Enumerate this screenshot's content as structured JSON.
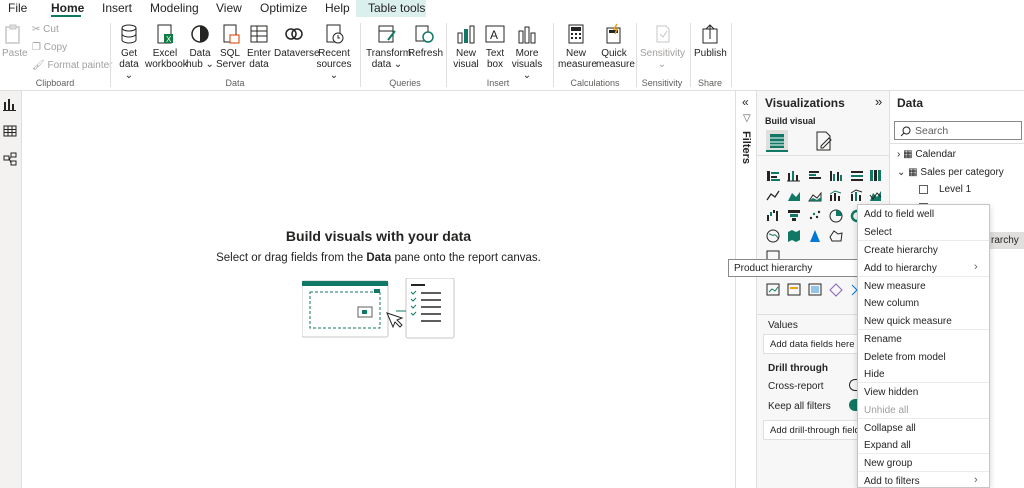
{
  "menubar": {
    "items": [
      "File",
      "Home",
      "Insert",
      "Modeling",
      "View",
      "Optimize",
      "Help",
      "Table tools"
    ],
    "active": "Home"
  },
  "ribbon": {
    "clipboard": {
      "paste": "Paste",
      "cut": "Cut",
      "copy": "Copy",
      "format_painter": "Format painter",
      "label": "Clipboard"
    },
    "data": {
      "get_data": [
        "Get",
        "data ⌄"
      ],
      "excel": [
        "Excel",
        "workbook"
      ],
      "data_hub": [
        "Data",
        "hub ⌄"
      ],
      "sql": [
        "SQL",
        "Server"
      ],
      "enter_data": [
        "Enter",
        "data"
      ],
      "dataverse": [
        "Dataverse"
      ],
      "recent": [
        "Recent",
        "sources ⌄"
      ],
      "label": "Data"
    },
    "queries": {
      "transform": [
        "Transform",
        "data ⌄"
      ],
      "refresh": [
        "Refresh"
      ],
      "label": "Queries"
    },
    "insert": {
      "new_visual": [
        "New",
        "visual"
      ],
      "text_box": [
        "Text",
        "box"
      ],
      "more_visuals": [
        "More",
        "visuals ⌄"
      ],
      "label": "Insert"
    },
    "calculations": {
      "new_measure": [
        "New",
        "measure"
      ],
      "quick_measure": [
        "Quick",
        "measure"
      ],
      "label": "Calculations"
    },
    "sensitivity": {
      "btn": [
        "Sensitivity",
        "⌄"
      ],
      "label": "Sensitivity"
    },
    "share": {
      "publish": [
        "Publish"
      ],
      "label": "Share"
    }
  },
  "canvas": {
    "heading": "Build visuals with your data",
    "sub_before": "Select or drag fields from the ",
    "sub_bold": "Data",
    "sub_after": " pane onto the report canvas."
  },
  "filters": {
    "label": "Filters"
  },
  "viz": {
    "title": "Visualizations",
    "build_visual": "Build visual",
    "values_label": "Values",
    "add_data_fields": "Add data fields here",
    "drill_through": "Drill through",
    "cross_report": "Cross-report",
    "keep_all_filters": "Keep all filters",
    "add_drill_fields": "Add drill-through fields"
  },
  "datapane": {
    "title": "Data",
    "search_placeholder": "Search",
    "tables": [
      "Calendar",
      "Sales per category"
    ],
    "fields": [
      "Level 1"
    ],
    "selected_partial": "rarchy"
  },
  "context_menu": {
    "items": [
      "Add to field well",
      "Select",
      "Create hierarchy",
      "Add to hierarchy",
      "New measure",
      "New column",
      "New quick measure",
      "Rename",
      "Delete from model",
      "Hide",
      "View hidden",
      "Unhide all",
      "Collapse all",
      "Expand all",
      "New group",
      "Add to filters"
    ],
    "disabled": [
      "Unhide all"
    ]
  },
  "tooltip": "Product hierarchy",
  "colors": {
    "accent": "#117865",
    "table_tools_bg": "#dbefec"
  }
}
